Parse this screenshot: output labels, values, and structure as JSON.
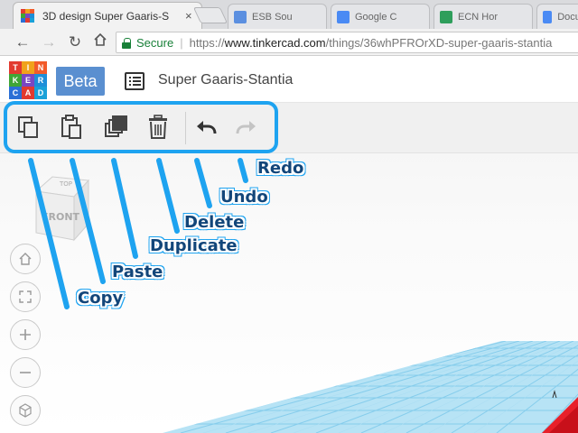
{
  "browser": {
    "active_tab": {
      "title": "3D design Super Gaaris-S",
      "close_glyph": "×"
    },
    "inactive_tabs": [
      {
        "title": "ESB Sou",
        "icon_color": "#5b8fe0"
      },
      {
        "title": "Google C",
        "icon_color": "#4a8af4"
      },
      {
        "title": "ECN Hor",
        "icon_color": "#2e9e5b"
      },
      {
        "title": "Docume",
        "icon_color": "#4a8af4"
      }
    ],
    "back_glyph": "←",
    "forward_glyph": "→",
    "reload_glyph": "↻",
    "secure_label": "Secure",
    "url_scheme": "https://",
    "url_host": "www.tinkercad.com",
    "url_path": "/things/36whPFROrXD-super-gaaris-stantia"
  },
  "app": {
    "logo_letters": [
      "T",
      "I",
      "N",
      "K",
      "E",
      "R",
      "C",
      "A",
      "D"
    ],
    "logo_colors": [
      "#e23a2f",
      "#f0a21b",
      "#f25b2a",
      "#3fa535",
      "#7a47c2",
      "#1e8ed8",
      "#2b6fd6",
      "#e23a2f",
      "#1aa1d8"
    ],
    "beta_label": "Beta",
    "design_title": "Super Gaaris-Stantia"
  },
  "toolbar": {
    "copy_icon": "copy-icon",
    "paste_icon": "paste-icon",
    "duplicate_icon": "duplicate-icon",
    "delete_icon": "trash-icon",
    "undo_icon": "undo-icon",
    "redo_icon": "redo-icon"
  },
  "viewcube": {
    "top_label": "TOP",
    "front_label": "FRONT"
  },
  "annotations": {
    "copy": "Copy",
    "paste": "Paste",
    "duplicate": "Duplicate",
    "delete": "Delete",
    "undo": "Undo",
    "redo": "Redo"
  },
  "colors": {
    "annotation_blue": "#1ea3f0",
    "grid_blue": "#8fd3f0",
    "object_red": "#e8202a"
  }
}
